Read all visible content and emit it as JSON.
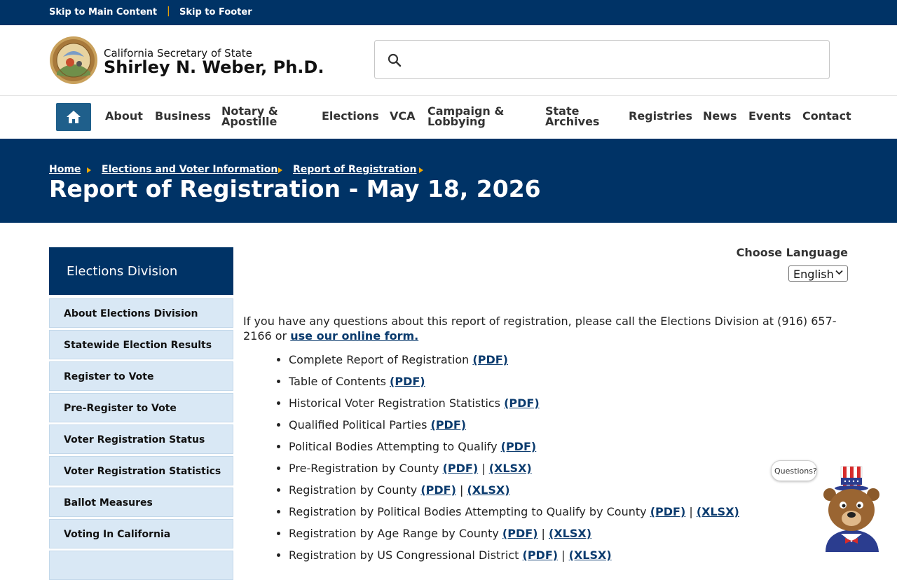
{
  "skip": {
    "main": "Skip to Main Content",
    "separator": "|",
    "footer": "Skip to Footer"
  },
  "header": {
    "agency": "California Secretary of State",
    "official": "Shirley N. Weber, Ph.D.",
    "seal_icon": "california-state-seal",
    "search": {
      "icon": "search-icon",
      "value": "",
      "placeholder": ""
    }
  },
  "nav": {
    "home_icon": "home-icon",
    "items": [
      {
        "label": "About"
      },
      {
        "label": "Business"
      },
      {
        "label": "Notary &",
        "label2": "Apostille"
      },
      {
        "label": "Elections"
      },
      {
        "label": "VCA"
      },
      {
        "label": "Campaign &",
        "label2": "Lobbying"
      },
      {
        "label": "State",
        "label2": "Archives"
      },
      {
        "label": "Registries"
      },
      {
        "label": "News"
      },
      {
        "label": "Events"
      },
      {
        "label": "Contact"
      }
    ]
  },
  "breadcrumb": [
    "Home",
    "Elections and Voter Information",
    "Report of Registration"
  ],
  "page_title": "Report of Registration - May 18, 2026",
  "sidebar": {
    "heading": "Elections Division",
    "items": [
      "About Elections Division",
      "Statewide Election Results",
      "Register to Vote",
      "Pre-Register to Vote",
      "Voter Registration Status",
      "Voter Registration Statistics",
      "Ballot Measures",
      "Voting In California"
    ]
  },
  "language": {
    "label": "Choose Language",
    "selected": "English"
  },
  "intro": {
    "text": "If you have any questions about this report of registration, please call the Elections Division at (916) 657-2166 or ",
    "link": "use our online form."
  },
  "reports": [
    {
      "title": "Complete Report of Registration",
      "pdf": "(PDF)",
      "xlsx": ""
    },
    {
      "title": "Table of Contents",
      "pdf": "(PDF)",
      "xlsx": ""
    },
    {
      "title": "Historical Voter Registration Statistics",
      "pdf": "(PDF)",
      "xlsx": ""
    },
    {
      "title": "Qualified Political Parties",
      "pdf": "(PDF)",
      "xlsx": ""
    },
    {
      "title": "Political Bodies Attempting to Qualify",
      "pdf": "(PDF)",
      "xlsx": ""
    },
    {
      "title": "Pre-Registration by County",
      "pdf": "(PDF)",
      "xlsx": "(XLSX)"
    },
    {
      "title": "Registration by County",
      "pdf": "(PDF)",
      "xlsx": "(XLSX)"
    },
    {
      "title": "Registration by Political Bodies Attempting to Qualify by County",
      "pdf": "(PDF)",
      "xlsx": "(XLSX)"
    },
    {
      "title": "Registration by Age Range by County",
      "pdf": "(PDF)",
      "xlsx": "(XLSX)"
    },
    {
      "title": "Registration by US Congressional District",
      "pdf": "(PDF)",
      "xlsx": "(XLSX)"
    }
  ],
  "chat": {
    "bubble": "Questions?",
    "icon": "chat-bear-mascot-icon"
  },
  "colors": {
    "navy": "#003366",
    "accent": "#f2a900",
    "link": "#0b3b6e",
    "sidebar": "#d9e8f5"
  }
}
